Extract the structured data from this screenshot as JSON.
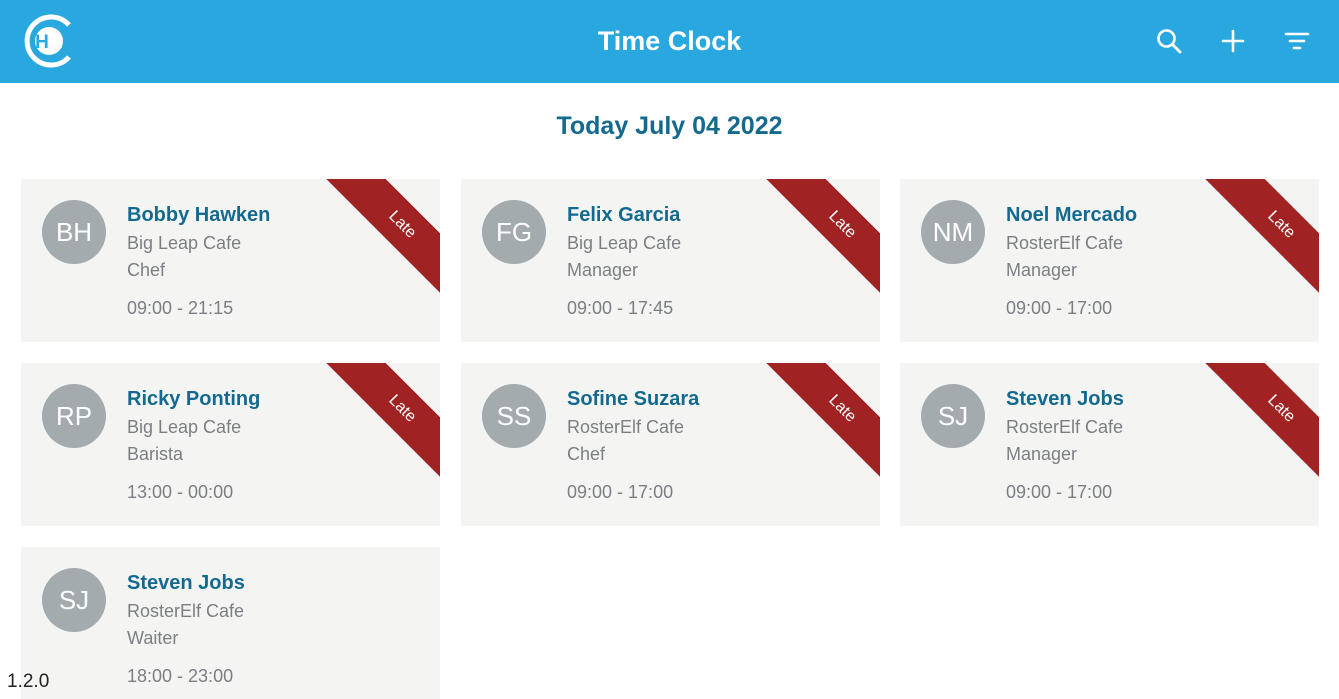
{
  "header": {
    "title": "Time Clock",
    "logo_text": "HR",
    "brand_color": "#29a8e0",
    "actions": [
      {
        "name": "search-button",
        "icon": "search-icon"
      },
      {
        "name": "add-button",
        "icon": "plus-icon"
      },
      {
        "name": "filter-button",
        "icon": "filter-icon"
      }
    ]
  },
  "date_heading": "Today July 04 2022",
  "cards": [
    {
      "initials": "BH",
      "name": "Bobby Hawken",
      "location": "Big Leap Cafe",
      "role": "Chef",
      "shift": "09:00 - 21:15",
      "status": "Late"
    },
    {
      "initials": "FG",
      "name": "Felix Garcia",
      "location": "Big Leap Cafe",
      "role": "Manager",
      "shift": "09:00 - 17:45",
      "status": "Late"
    },
    {
      "initials": "NM",
      "name": "Noel Mercado",
      "location": "RosterElf Cafe",
      "role": "Manager",
      "shift": "09:00 - 17:00",
      "status": "Late"
    },
    {
      "initials": "RP",
      "name": "Ricky Ponting",
      "location": "Big Leap Cafe",
      "role": "Barista",
      "shift": "13:00 - 00:00",
      "status": "Late"
    },
    {
      "initials": "SS",
      "name": "Sofine Suzara",
      "location": "RosterElf Cafe",
      "role": "Chef",
      "shift": "09:00 - 17:00",
      "status": "Late"
    },
    {
      "initials": "SJ",
      "name": "Steven Jobs",
      "location": "RosterElf Cafe",
      "role": "Manager",
      "shift": "09:00 - 17:00",
      "status": "Late"
    },
    {
      "initials": "SJ",
      "name": "Steven Jobs",
      "location": "RosterElf Cafe",
      "role": "Waiter",
      "shift": "18:00 - 23:00",
      "status": ""
    }
  ],
  "version": "1.2.0",
  "colors": {
    "accent": "#14698f",
    "late_ribbon": "#a02222",
    "card_bg": "#f4f4f3",
    "avatar_bg": "#a4abae"
  }
}
